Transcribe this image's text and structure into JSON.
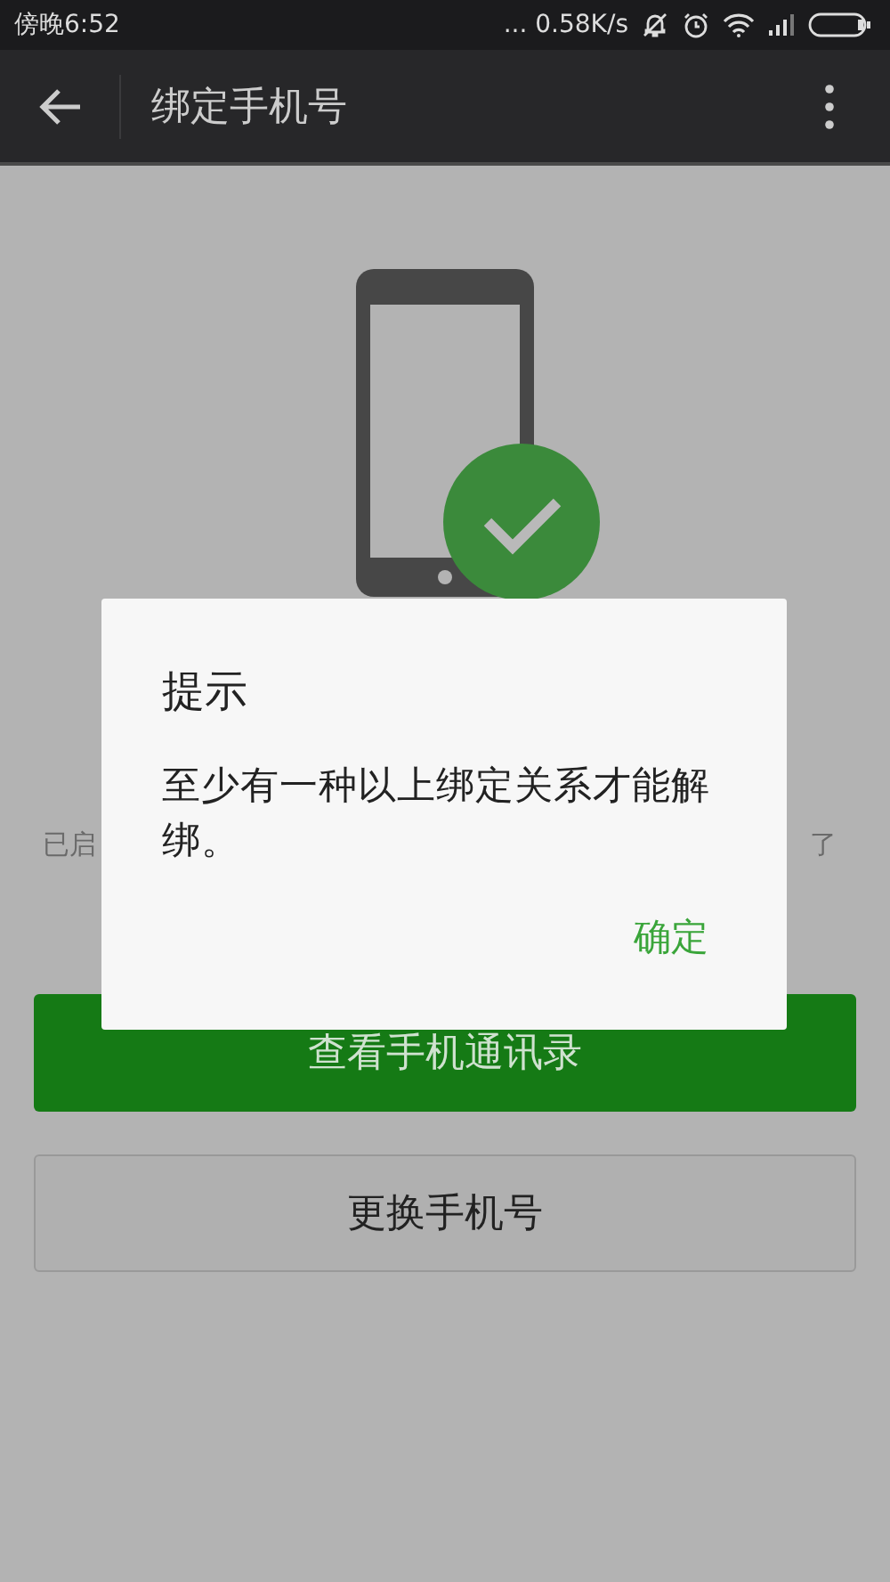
{
  "status_bar": {
    "time": "傍晚6:52",
    "speed": "... 0.58K/s"
  },
  "toolbar": {
    "title": "绑定手机号"
  },
  "background_text": [
    {
      "text": "已启"
    },
    {
      "text": "了"
    }
  ],
  "buttons": [
    {
      "label": "查看手机通讯录",
      "kind": "primary"
    },
    {
      "label": "更换手机号",
      "kind": "secondary"
    }
  ],
  "dialog": {
    "title": "提示",
    "message": "至少有一种以上绑定关系才能解绑。",
    "action": "确定"
  }
}
